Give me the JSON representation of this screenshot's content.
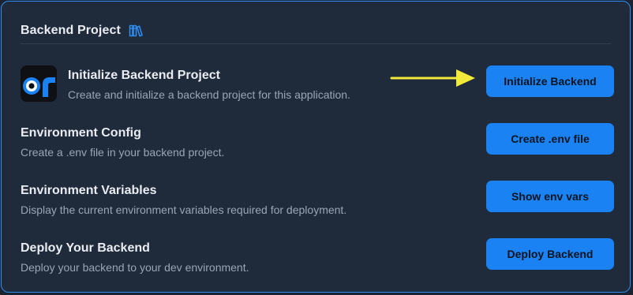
{
  "section": {
    "title": "Backend Project",
    "icon": "books-icon"
  },
  "rows": [
    {
      "title": "Initialize Backend Project",
      "description": "Create and initialize a backend project for this application.",
      "button": "Initialize Backend",
      "icon": "app-logo-icon"
    },
    {
      "title": "Environment Config",
      "description": "Create a .env file in your backend project.",
      "button": "Create .env file"
    },
    {
      "title": "Environment Variables",
      "description": "Display the current environment variables required for deployment.",
      "button": "Show env vars"
    },
    {
      "title": "Deploy Your Backend",
      "description": "Deploy your backend to your dev environment.",
      "button": "Deploy Backend"
    }
  ],
  "annotation": {
    "icon": "arrow-right-icon",
    "color": "#f2ea3a"
  },
  "colors": {
    "accent": "#1a82f2",
    "card_border": "#2f8df2",
    "card_bg": "#1f2a3a"
  }
}
